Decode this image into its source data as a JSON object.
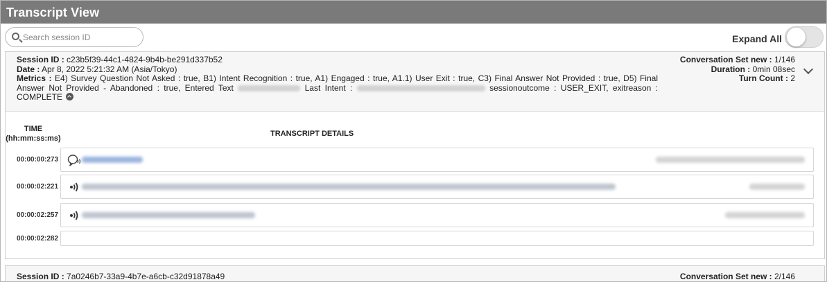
{
  "header": {
    "title": "Transcript View"
  },
  "search": {
    "placeholder": "Search session ID",
    "value": ""
  },
  "expand_all": {
    "label": "Expand All",
    "on": false
  },
  "sessions": [
    {
      "session_id_label": "Session ID :",
      "session_id": "c23b5f39-44c1-4824-9b4b-be291d337b52",
      "date_label": "Date :",
      "date": "Apr 8, 2022 5:21:32 AM (Asia/Tokyo)",
      "metrics_label": "Metrics :",
      "metrics_part1": "E4) Survey Question Not Asked : true, B1) Intent Recognition : true, A1) Engaged : true, A1.1) User Exit : true, C3) Final Answer Not Provided : true, D5) Final Answer Not Provided - Abandoned : true, Entered Text",
      "metrics_part2": "Last Intent :",
      "metrics_part3": "sessionoutcome : USER_EXIT, exitreason :",
      "metrics_part4": "COMPLETE",
      "conversation_set_label": "Conversation Set new :",
      "conversation_set": "1/146",
      "duration_label": "Duration :",
      "duration": "0min 08sec",
      "turn_count_label": "Turn Count :",
      "turn_count": "2",
      "columns": {
        "time": "TIME",
        "time_format": "(hh:mm:ss:ms)",
        "details": "TRANSCRIPT DETAILS"
      },
      "turns": [
        {
          "time": "00:00:00:273",
          "speaker": "user"
        },
        {
          "time": "00:00:02:221",
          "speaker": "bot"
        },
        {
          "time": "00:00:02:257",
          "speaker": "bot"
        },
        {
          "time": "00:00:02:282",
          "speaker": "none"
        }
      ]
    },
    {
      "session_id_label": "Session ID :",
      "session_id": "7a0246b7-33a9-4b7e-a6cb-c32d91878a49",
      "conversation_set_label": "Conversation Set new :",
      "conversation_set": "2/146"
    }
  ]
}
